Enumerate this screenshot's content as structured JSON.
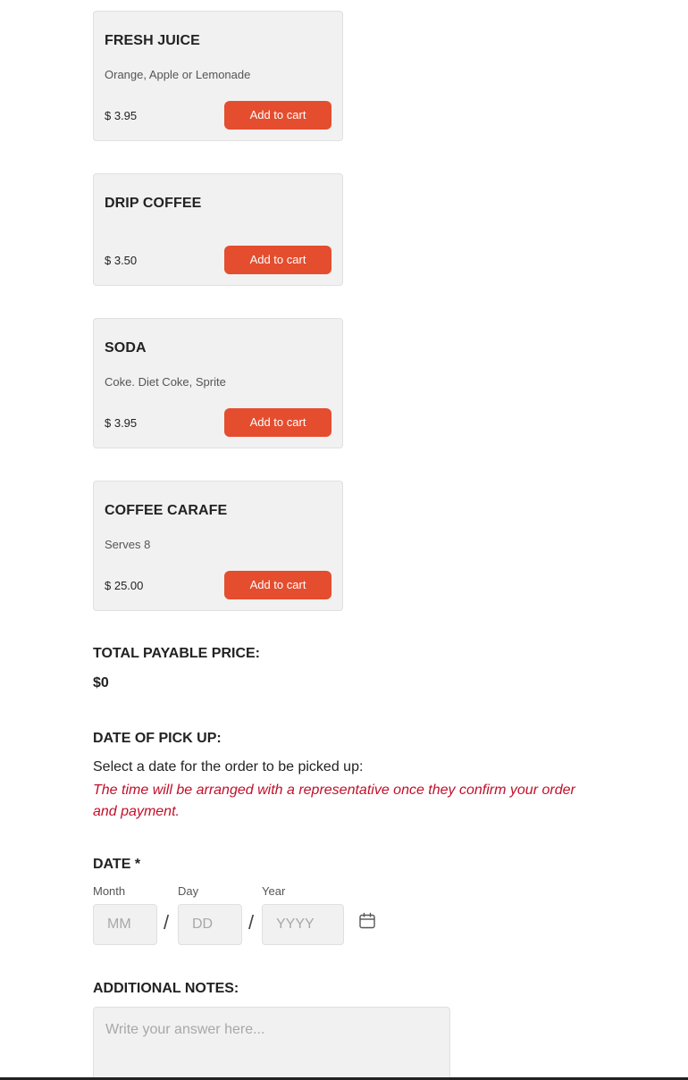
{
  "menu_items": [
    {
      "title": "FRESH JUICE",
      "description": "Orange, Apple or Lemonade",
      "price": "$ 3.95",
      "button_label": "Add to cart"
    },
    {
      "title": "DRIP COFFEE",
      "description": "",
      "price": "$ 3.50",
      "button_label": "Add to cart"
    },
    {
      "title": "SODA",
      "description": "Coke. Diet Coke, Sprite",
      "price": "$ 3.95",
      "button_label": "Add to cart"
    },
    {
      "title": "COFFEE CARAFE",
      "description": "Serves 8",
      "price": "$ 25.00",
      "button_label": "Add to cart"
    }
  ],
  "total": {
    "heading": "TOTAL PAYABLE PRICE:",
    "value": "$0"
  },
  "pickup": {
    "heading": "DATE OF PICK UP:",
    "text": "Select a date for the order to be picked up:",
    "note": "The time will be arranged with a representative once they confirm your order and payment."
  },
  "date": {
    "heading": "DATE *",
    "month_label": "Month",
    "day_label": "Day",
    "year_label": "Year",
    "month_placeholder": "MM",
    "day_placeholder": "DD",
    "year_placeholder": "YYYY",
    "separator": "/"
  },
  "notes": {
    "heading": "ADDITIONAL NOTES:",
    "placeholder": "Write your answer here..."
  },
  "colors": {
    "button": "#e44d2e",
    "note_text": "#c0102a",
    "card_bg": "#f1f1f1"
  }
}
